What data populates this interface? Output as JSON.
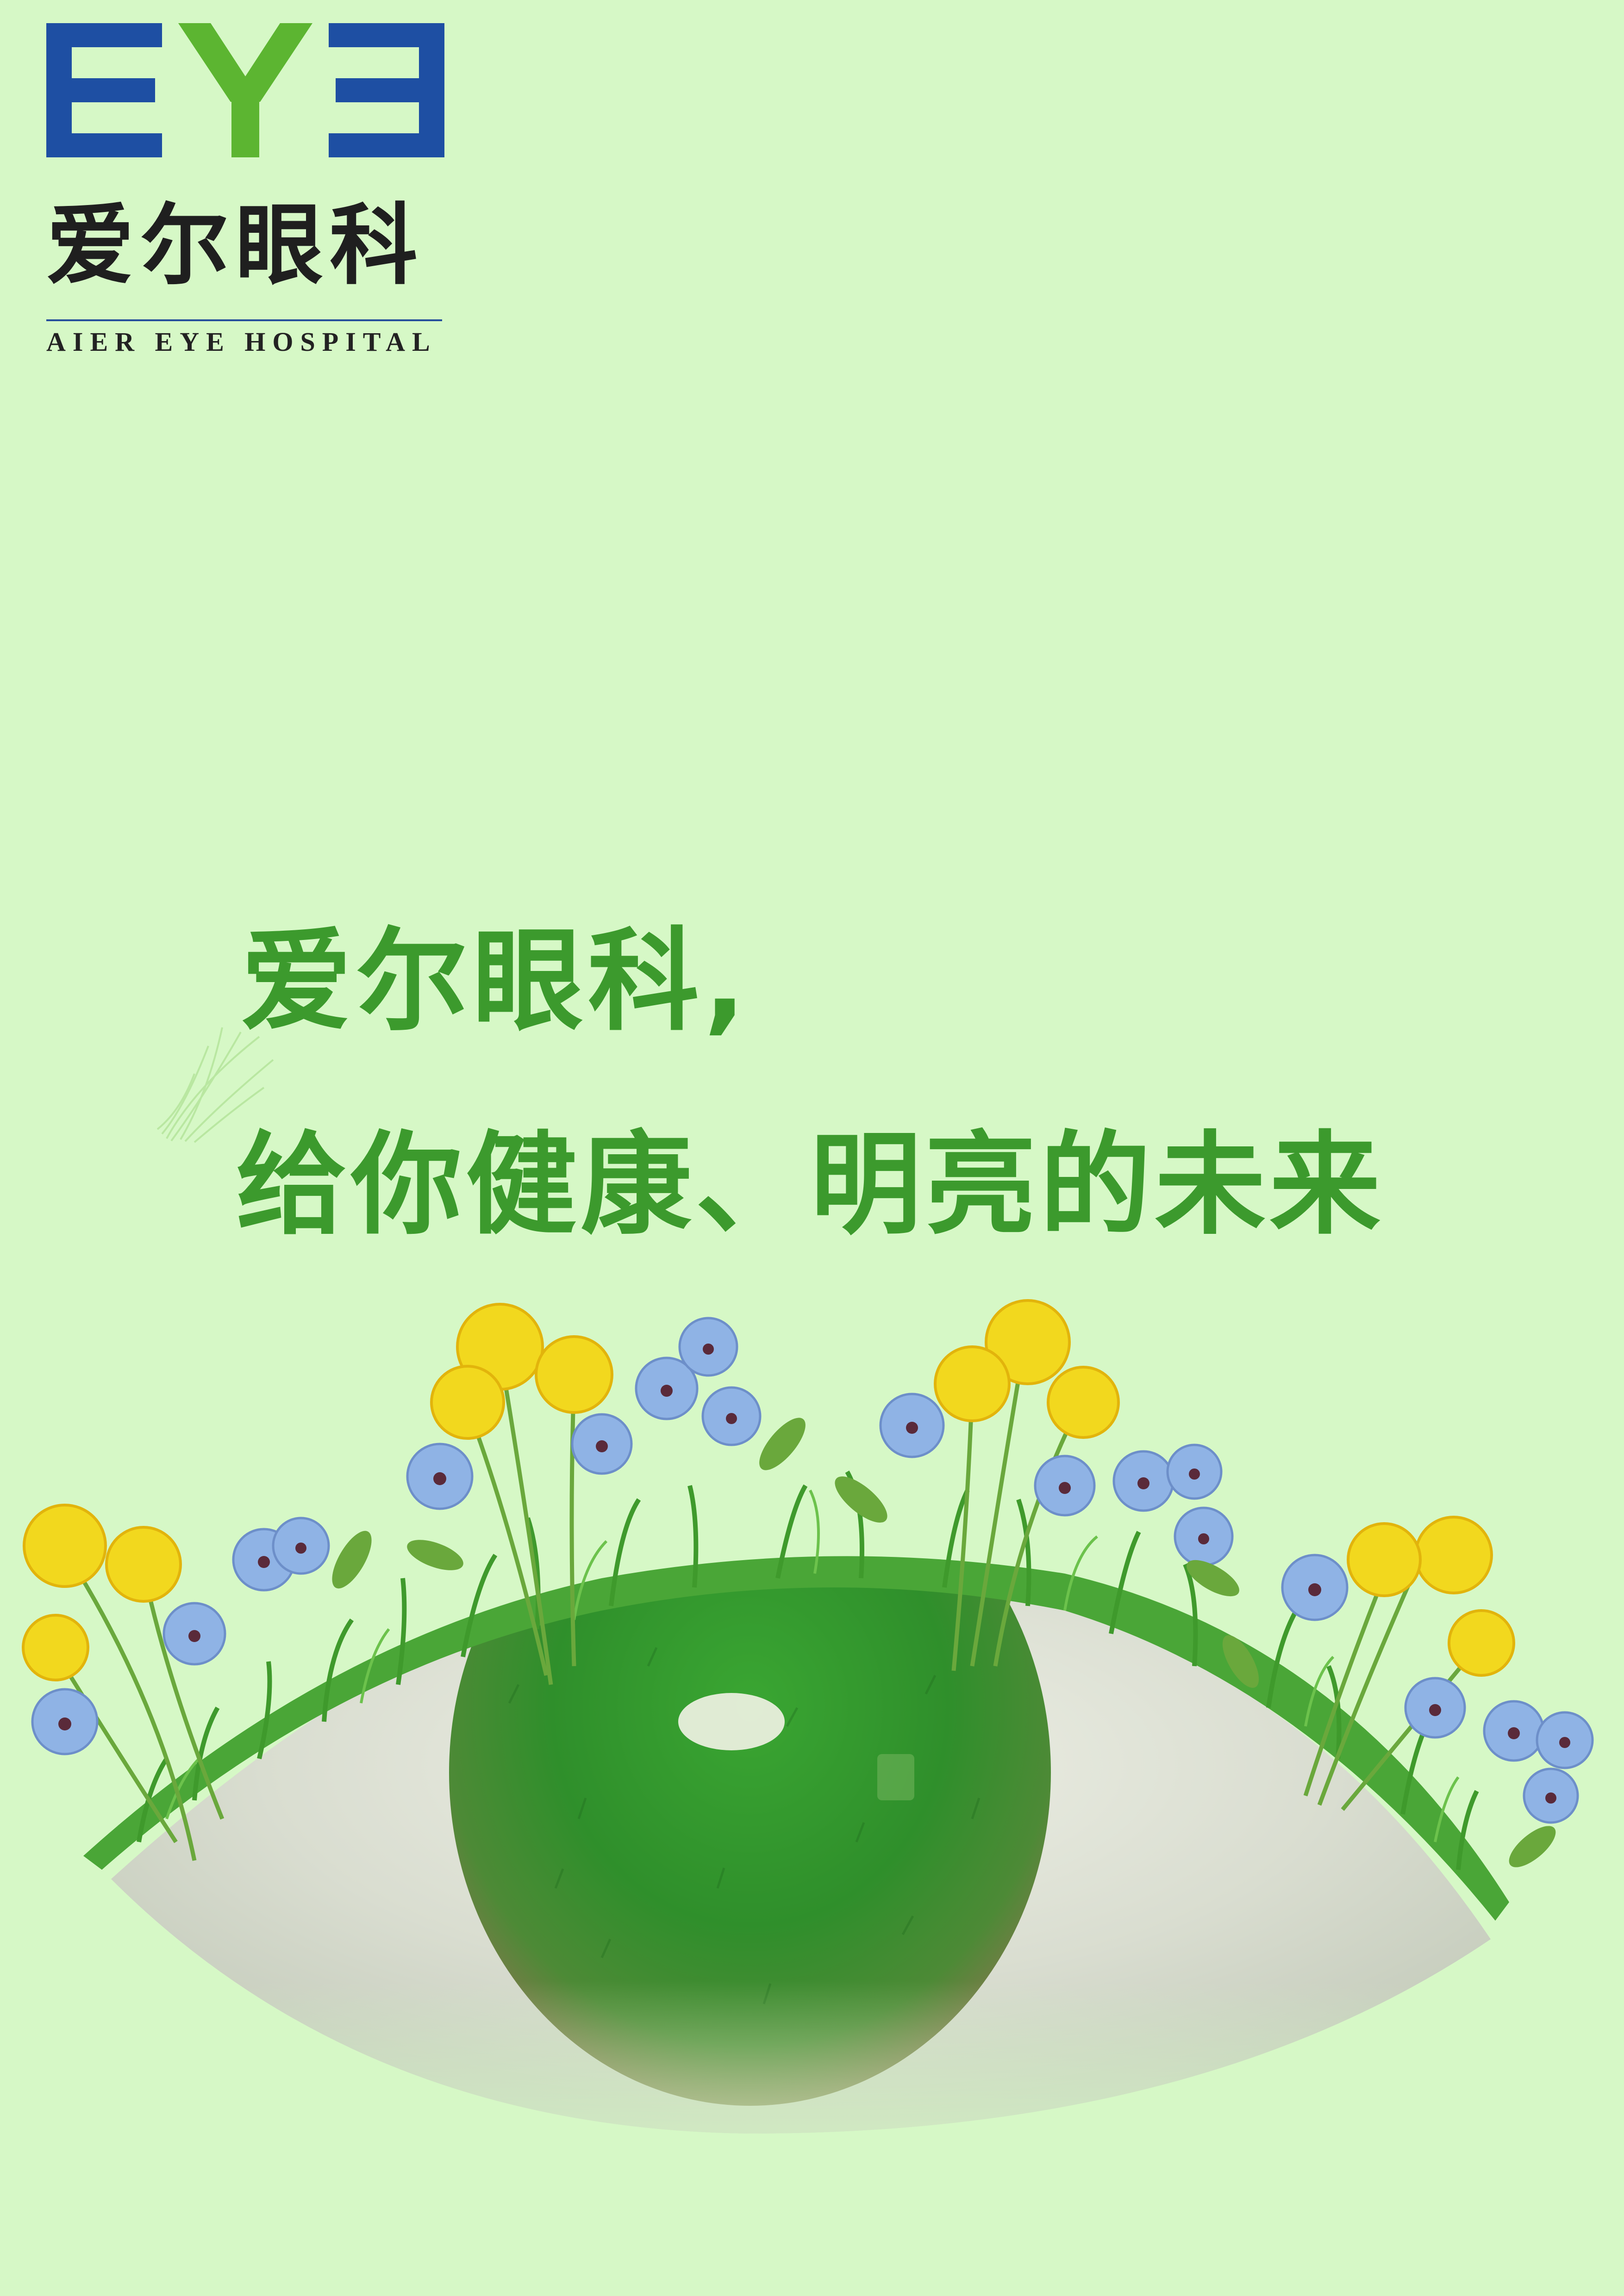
{
  "brand": {
    "logo_mark_text": "EYE",
    "chinese_name": "爱尔眼科",
    "english_name": "AIER EYE HOSPITAL",
    "colors": {
      "blue": "#1e4fa3",
      "green": "#5cb531",
      "text_dark": "#1f1f1f"
    }
  },
  "slogan": {
    "line1": "爱尔眼科,",
    "line2": "给你健康、明亮的未来",
    "color": "#3c9a2d"
  },
  "illustration": {
    "subject": "grass-eye",
    "background_color": "#d6f8c6"
  }
}
